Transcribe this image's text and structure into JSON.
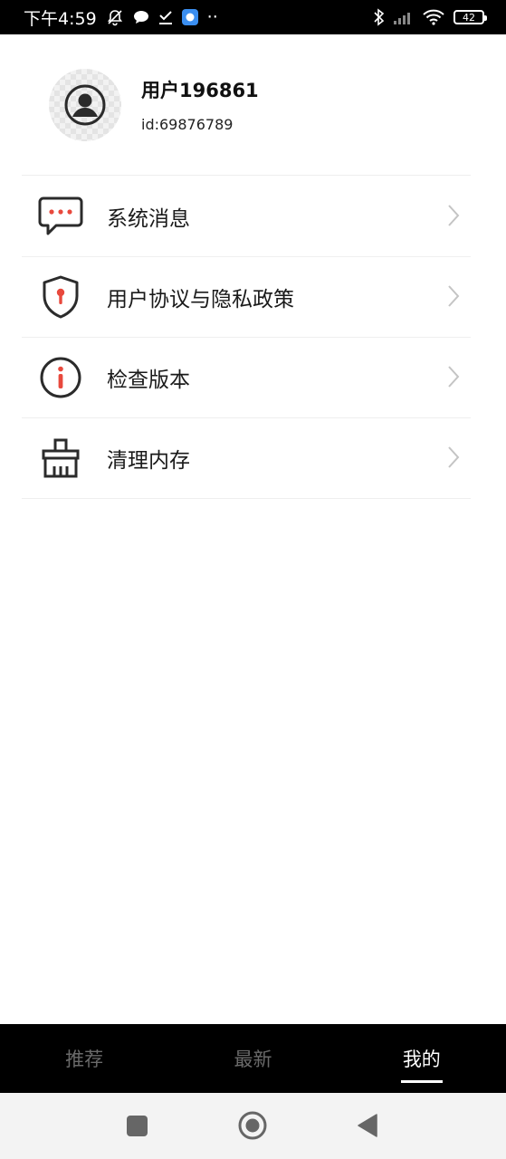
{
  "status_bar": {
    "time": "下午4:59",
    "battery": "42",
    "dots": "··"
  },
  "profile": {
    "name": "用户196861",
    "id": "id:69876789"
  },
  "menu": {
    "items": [
      {
        "label": "系统消息",
        "icon": "message-icon"
      },
      {
        "label": "用户协议与隐私政策",
        "icon": "shield-icon"
      },
      {
        "label": "检查版本",
        "icon": "info-icon"
      },
      {
        "label": "清理内存",
        "icon": "broom-icon"
      }
    ]
  },
  "tabs": [
    {
      "label": "推荐",
      "active": false
    },
    {
      "label": "最新",
      "active": false
    },
    {
      "label": "我的",
      "active": true
    }
  ],
  "colors": {
    "accent": "#e8493d",
    "dark": "#2b2b2b",
    "tabbar": "#000000"
  }
}
